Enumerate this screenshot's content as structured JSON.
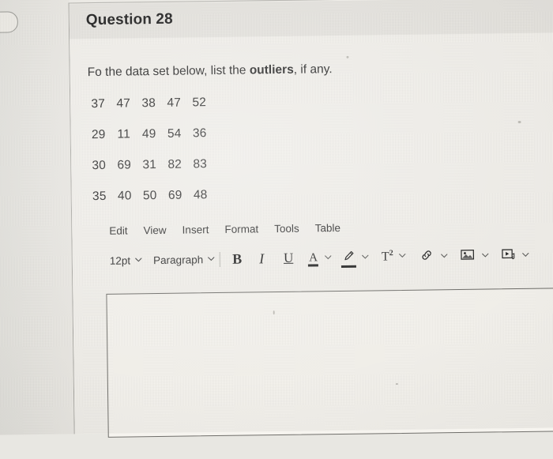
{
  "header": {
    "title": "Question 28"
  },
  "question": {
    "prompt_before": "Fo the data set below, list the ",
    "prompt_bold": "outliers",
    "prompt_after": ", if any.",
    "data_rows": [
      [
        "37",
        "47",
        "38",
        "47",
        "52"
      ],
      [
        "29",
        "11",
        "49",
        "54",
        "36"
      ],
      [
        "30",
        "69",
        "31",
        "82",
        "83"
      ],
      [
        "35",
        "40",
        "50",
        "69",
        "48"
      ]
    ]
  },
  "editor": {
    "menu": [
      {
        "label": "Edit",
        "name": "menu-edit"
      },
      {
        "label": "View",
        "name": "menu-view"
      },
      {
        "label": "Insert",
        "name": "menu-insert"
      },
      {
        "label": "Format",
        "name": "menu-format"
      },
      {
        "label": "Tools",
        "name": "menu-tools"
      },
      {
        "label": "Table",
        "name": "menu-table"
      }
    ],
    "toolbar": {
      "font_size": "12pt",
      "block_format": "Paragraph",
      "bold": "B",
      "italic": "I",
      "underline": "U",
      "text_color": "A",
      "superscript": "T",
      "superscript_exp": "2"
    },
    "body_value": "",
    "body_placeholder": ""
  },
  "colors": {
    "screen_bg": "#f0eee9",
    "header_bg": "#e6e4df",
    "text": "#232323",
    "border": "#a8a7a2",
    "box_border": "#6f6e6a"
  }
}
